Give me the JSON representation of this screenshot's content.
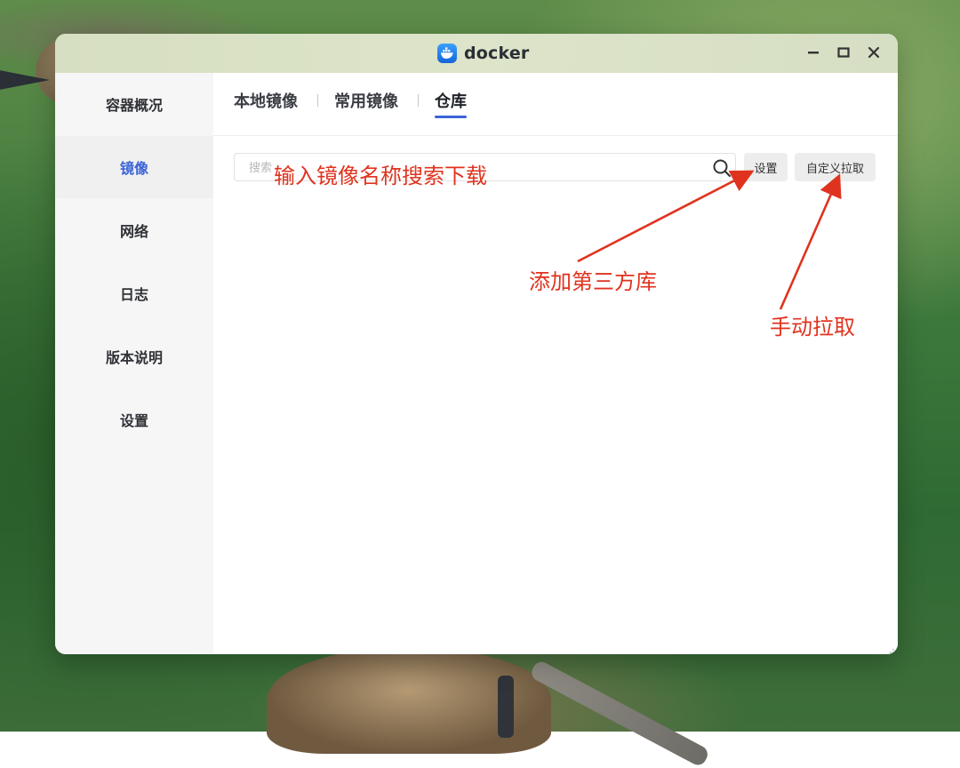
{
  "window": {
    "title": "docker",
    "controls": {
      "minimize_icon": "minus-icon",
      "maximize_icon": "square-icon",
      "close_icon": "x-icon"
    }
  },
  "sidebar": {
    "items": [
      {
        "label": "容器概况"
      },
      {
        "label": "镜像",
        "active": true
      },
      {
        "label": "网络"
      },
      {
        "label": "日志"
      },
      {
        "label": "版本说明"
      },
      {
        "label": "设置"
      }
    ]
  },
  "tabs": [
    {
      "label": "本地镜像"
    },
    {
      "label": "常用镜像"
    },
    {
      "label": "仓库",
      "active": true
    }
  ],
  "search": {
    "placeholder": "搜索",
    "value": ""
  },
  "buttons": {
    "settings": "设置",
    "custom_pull": "自定义拉取"
  },
  "annotations": {
    "search_hint": "输入镜像名称搜索下载",
    "settings_hint": "添加第三方库",
    "pull_hint": "手动拉取"
  },
  "colors": {
    "accent": "#3b63d9",
    "annotation": "#e0331f"
  }
}
